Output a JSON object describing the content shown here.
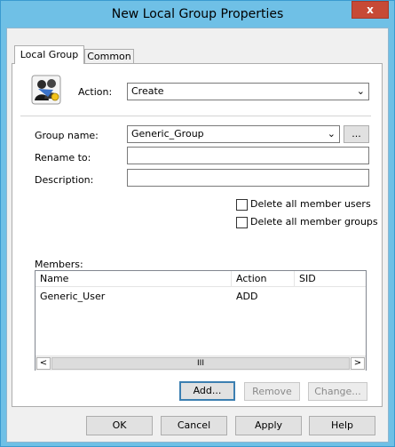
{
  "window": {
    "title": "New Local Group Properties",
    "close_glyph": "x"
  },
  "tabs": [
    {
      "label": "Local Group"
    },
    {
      "label": "Common"
    }
  ],
  "form": {
    "action_label": "Action:",
    "action_value": "Create",
    "group_name_label": "Group name:",
    "group_name_value": "Generic_Group",
    "browse_button": "...",
    "rename_label": "Rename to:",
    "rename_value": "",
    "description_label": "Description:",
    "description_value": "",
    "delete_users_label": "Delete all member users",
    "delete_groups_label": "Delete all member groups",
    "members_label": "Members:"
  },
  "members": {
    "columns": [
      "Name",
      "Action",
      "SID"
    ],
    "rows": [
      {
        "name": "Generic_User",
        "action": "ADD",
        "sid": ""
      }
    ],
    "scroll_left": "<",
    "scroll_right": ">",
    "scroll_thumb": "III"
  },
  "member_buttons": {
    "add": "Add...",
    "remove": "Remove",
    "change": "Change..."
  },
  "footer": {
    "ok": "OK",
    "cancel": "Cancel",
    "apply": "Apply",
    "help": "Help"
  }
}
